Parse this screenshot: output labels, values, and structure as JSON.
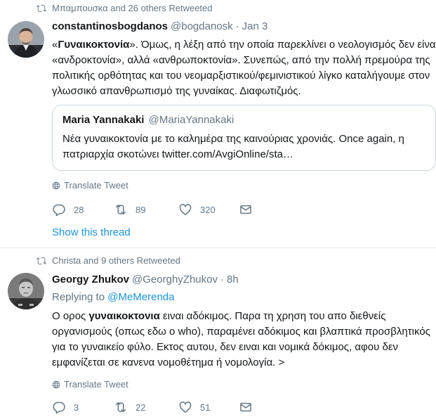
{
  "tweets": [
    {
      "retweet_context": "Μπαμπουσκα and 26 others Retweeted",
      "author": {
        "name": "constantinosbogdanos",
        "handle": "@bogdanosk",
        "time": "Jan 3"
      },
      "text": {
        "l1_pre": "«",
        "l1_bold": "Γυναικοκτονία",
        "l1_post": "». Όμως, η λέξη από την οποία παρεκλίνει ο νεολογισμός δεν είναι",
        "l2": "«ανδροκτονία», αλλά «ανθρωποκτονία». Συνεπώς, από την πολλή πρεμούρα της",
        "l3": "πολιτικής ορθότητας και του νεομαρξιστικού/φεμινιστικού λίγκο καταλήγουμε στον",
        "l4": "γλωσσικό απανθρωπισμό της γυναίκας. Διαφωτιζμός."
      },
      "quoted": {
        "name": "Maria Yannakaki",
        "handle": "@MariaYannakaki",
        "l1": "Νέα γυναικοκτονία με το καλημέρα της καινούριας χρονιάς. Once again, η",
        "l2": "πατριαρχία σκοτώνει twitter.com/AvgiOnline/sta…"
      },
      "translate_label": "Translate Tweet",
      "counts": {
        "replies": "28",
        "retweets": "89",
        "likes": "320"
      },
      "show_thread": "Show this thread"
    },
    {
      "retweet_context": "Christa and 9 others Retweeted",
      "author": {
        "name": "Georgy Zhukov",
        "handle": "@GeorghyZhukov",
        "time": "8h"
      },
      "replying_label": "Replying to",
      "replying_to": "@MeMerenda",
      "text": {
        "l1_pre": "Ο ορος ",
        "l1_bold": "γυναικοκτονια",
        "l1_post": " ειναι αδόκιμος. Παρα τη χρηση του απο διεθνείς",
        "l2": "οργανισμούς (οπως εδω ο who), παραμένει αδόκιμος και βλαπτικά προσβλητικός",
        "l3": "για το γυναικείο φύλο. Εκτος αυτου, δεν ειναι και νομικά δόκιμος, αφου δεν",
        "l4": "εμφανίζεται σε κανενα νομοθέτημα ή νομολογία. >"
      },
      "translate_label": "Translate Tweet",
      "counts": {
        "replies": "3",
        "retweets": "22",
        "likes": "51"
      }
    }
  ],
  "icons": {
    "retweet": "retweet-icon",
    "reply": "reply-icon",
    "like": "heart-icon",
    "dm": "envelope-icon",
    "translate": "globe-icon"
  },
  "colors": {
    "link": "#1b95e0",
    "secondary_text": "#657786",
    "border": "#e6ecf0"
  }
}
